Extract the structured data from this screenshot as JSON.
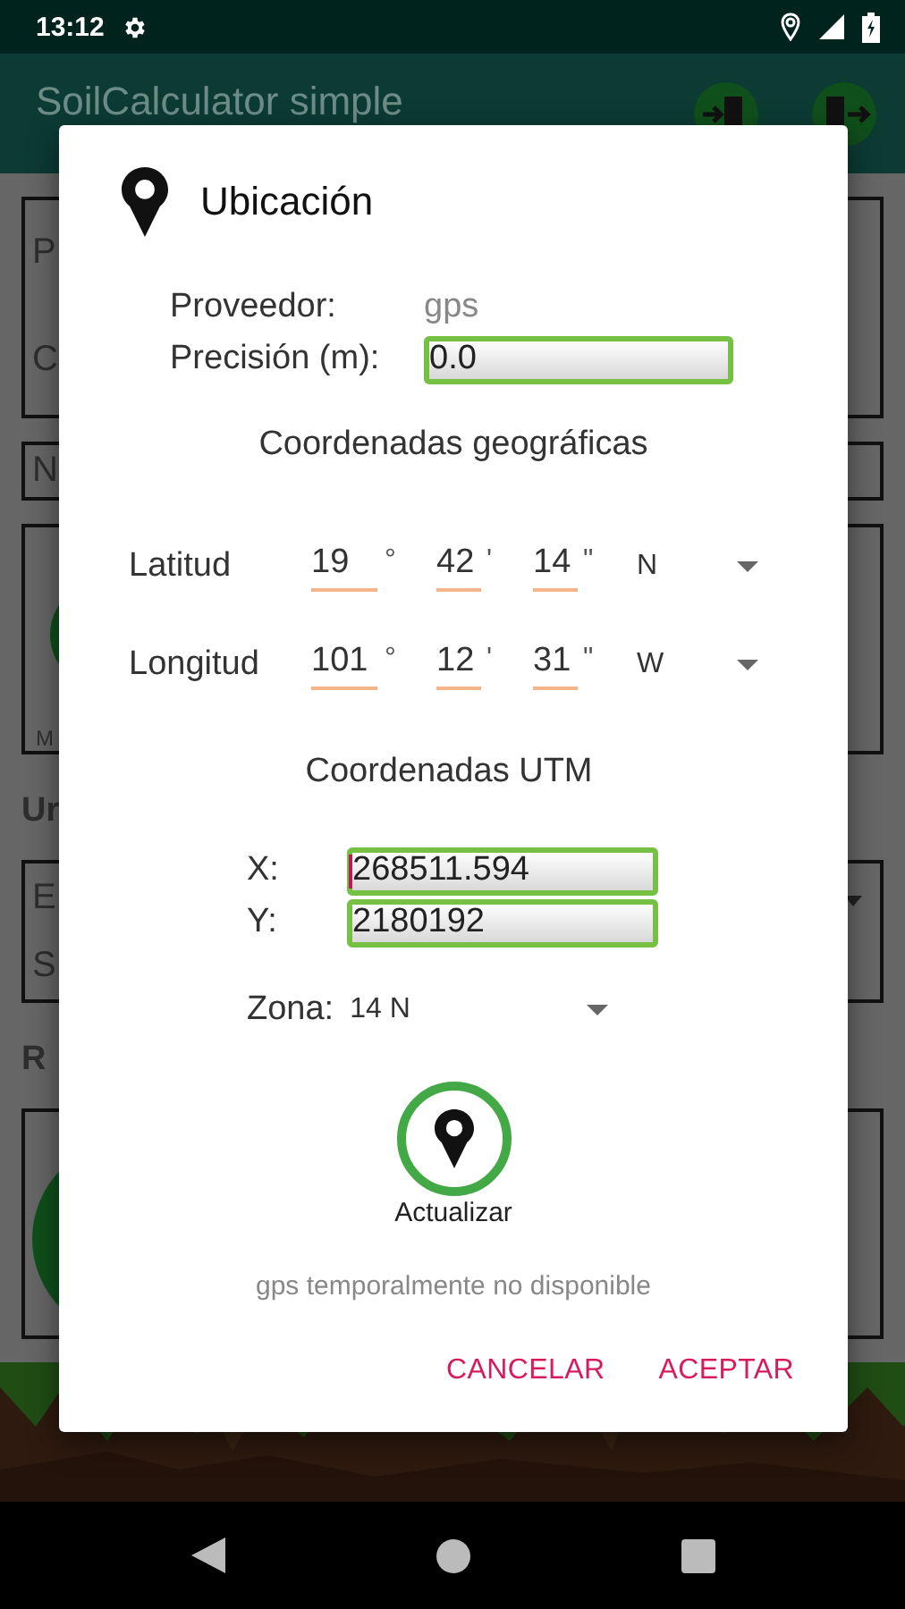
{
  "status_bar": {
    "time": "13:12"
  },
  "app_bar": {
    "title": "SoilCalculator simple"
  },
  "background": {
    "items": [
      {
        "kind": "text-card",
        "lines": [
          "P",
          "C"
        ],
        "dropdown": false
      },
      {
        "kind": "text-card",
        "lines": [
          "N"
        ],
        "dropdown": false
      },
      {
        "kind": "graphic-card",
        "caption": "M"
      },
      {
        "kind": "heading",
        "text": "Ur"
      },
      {
        "kind": "text-card",
        "lines": [
          "E",
          "S"
        ],
        "dropdown": true
      },
      {
        "kind": "heading",
        "text": "R"
      },
      {
        "kind": "graphic-card"
      }
    ]
  },
  "dialog": {
    "title": "Ubicación",
    "provider": {
      "label": "Proveedor:",
      "value": "gps"
    },
    "accuracy": {
      "label": "Precisión (m):",
      "value": "0.0"
    },
    "geo": {
      "heading": "Coordenadas geográficas",
      "rows": [
        {
          "label": "Latitud",
          "degrees": "19",
          "degree_mark": "°",
          "minutes": "42",
          "minute_mark": "'",
          "seconds": "14",
          "second_mark": "\"",
          "hemisphere": "N"
        },
        {
          "label": "Longitud",
          "degrees": "101",
          "degree_mark": "°",
          "minutes": "12",
          "minute_mark": "'",
          "seconds": "31",
          "second_mark": "\"",
          "hemisphere": "W"
        }
      ]
    },
    "utm": {
      "heading": "Coordenadas UTM",
      "fields": [
        {
          "label": "X:",
          "value": "268511.594",
          "focused": true
        },
        {
          "label": "Y:",
          "value": "2180192",
          "focused": false
        }
      ],
      "zone": {
        "label": "Zona:",
        "value": "14 N"
      }
    },
    "update": {
      "label": "Actualizar"
    },
    "status": "gps temporalmente no disponible",
    "buttons": [
      {
        "label": "CANCELAR"
      },
      {
        "label": "ACEPTAR"
      }
    ]
  }
}
